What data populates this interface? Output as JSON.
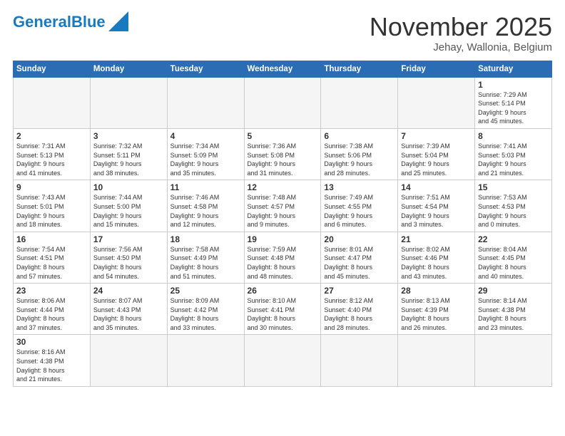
{
  "header": {
    "logo_general": "General",
    "logo_blue": "Blue",
    "main_title": "November 2025",
    "subtitle": "Jehay, Wallonia, Belgium"
  },
  "weekdays": [
    "Sunday",
    "Monday",
    "Tuesday",
    "Wednesday",
    "Thursday",
    "Friday",
    "Saturday"
  ],
  "days": [
    {
      "date": "",
      "info": ""
    },
    {
      "date": "",
      "info": ""
    },
    {
      "date": "",
      "info": ""
    },
    {
      "date": "",
      "info": ""
    },
    {
      "date": "",
      "info": ""
    },
    {
      "date": "",
      "info": ""
    },
    {
      "date": "1",
      "info": "Sunrise: 7:29 AM\nSunset: 5:14 PM\nDaylight: 9 hours\nand 45 minutes."
    },
    {
      "date": "2",
      "info": "Sunrise: 7:31 AM\nSunset: 5:13 PM\nDaylight: 9 hours\nand 41 minutes."
    },
    {
      "date": "3",
      "info": "Sunrise: 7:32 AM\nSunset: 5:11 PM\nDaylight: 9 hours\nand 38 minutes."
    },
    {
      "date": "4",
      "info": "Sunrise: 7:34 AM\nSunset: 5:09 PM\nDaylight: 9 hours\nand 35 minutes."
    },
    {
      "date": "5",
      "info": "Sunrise: 7:36 AM\nSunset: 5:08 PM\nDaylight: 9 hours\nand 31 minutes."
    },
    {
      "date": "6",
      "info": "Sunrise: 7:38 AM\nSunset: 5:06 PM\nDaylight: 9 hours\nand 28 minutes."
    },
    {
      "date": "7",
      "info": "Sunrise: 7:39 AM\nSunset: 5:04 PM\nDaylight: 9 hours\nand 25 minutes."
    },
    {
      "date": "8",
      "info": "Sunrise: 7:41 AM\nSunset: 5:03 PM\nDaylight: 9 hours\nand 21 minutes."
    },
    {
      "date": "9",
      "info": "Sunrise: 7:43 AM\nSunset: 5:01 PM\nDaylight: 9 hours\nand 18 minutes."
    },
    {
      "date": "10",
      "info": "Sunrise: 7:44 AM\nSunset: 5:00 PM\nDaylight: 9 hours\nand 15 minutes."
    },
    {
      "date": "11",
      "info": "Sunrise: 7:46 AM\nSunset: 4:58 PM\nDaylight: 9 hours\nand 12 minutes."
    },
    {
      "date": "12",
      "info": "Sunrise: 7:48 AM\nSunset: 4:57 PM\nDaylight: 9 hours\nand 9 minutes."
    },
    {
      "date": "13",
      "info": "Sunrise: 7:49 AM\nSunset: 4:55 PM\nDaylight: 9 hours\nand 6 minutes."
    },
    {
      "date": "14",
      "info": "Sunrise: 7:51 AM\nSunset: 4:54 PM\nDaylight: 9 hours\nand 3 minutes."
    },
    {
      "date": "15",
      "info": "Sunrise: 7:53 AM\nSunset: 4:53 PM\nDaylight: 9 hours\nand 0 minutes."
    },
    {
      "date": "16",
      "info": "Sunrise: 7:54 AM\nSunset: 4:51 PM\nDaylight: 8 hours\nand 57 minutes."
    },
    {
      "date": "17",
      "info": "Sunrise: 7:56 AM\nSunset: 4:50 PM\nDaylight: 8 hours\nand 54 minutes."
    },
    {
      "date": "18",
      "info": "Sunrise: 7:58 AM\nSunset: 4:49 PM\nDaylight: 8 hours\nand 51 minutes."
    },
    {
      "date": "19",
      "info": "Sunrise: 7:59 AM\nSunset: 4:48 PM\nDaylight: 8 hours\nand 48 minutes."
    },
    {
      "date": "20",
      "info": "Sunrise: 8:01 AM\nSunset: 4:47 PM\nDaylight: 8 hours\nand 45 minutes."
    },
    {
      "date": "21",
      "info": "Sunrise: 8:02 AM\nSunset: 4:46 PM\nDaylight: 8 hours\nand 43 minutes."
    },
    {
      "date": "22",
      "info": "Sunrise: 8:04 AM\nSunset: 4:45 PM\nDaylight: 8 hours\nand 40 minutes."
    },
    {
      "date": "23",
      "info": "Sunrise: 8:06 AM\nSunset: 4:44 PM\nDaylight: 8 hours\nand 37 minutes."
    },
    {
      "date": "24",
      "info": "Sunrise: 8:07 AM\nSunset: 4:43 PM\nDaylight: 8 hours\nand 35 minutes."
    },
    {
      "date": "25",
      "info": "Sunrise: 8:09 AM\nSunset: 4:42 PM\nDaylight: 8 hours\nand 33 minutes."
    },
    {
      "date": "26",
      "info": "Sunrise: 8:10 AM\nSunset: 4:41 PM\nDaylight: 8 hours\nand 30 minutes."
    },
    {
      "date": "27",
      "info": "Sunrise: 8:12 AM\nSunset: 4:40 PM\nDaylight: 8 hours\nand 28 minutes."
    },
    {
      "date": "28",
      "info": "Sunrise: 8:13 AM\nSunset: 4:39 PM\nDaylight: 8 hours\nand 26 minutes."
    },
    {
      "date": "29",
      "info": "Sunrise: 8:14 AM\nSunset: 4:38 PM\nDaylight: 8 hours\nand 23 minutes."
    },
    {
      "date": "30",
      "info": "Sunrise: 8:16 AM\nSunset: 4:38 PM\nDaylight: 8 hours\nand 21 minutes."
    }
  ]
}
